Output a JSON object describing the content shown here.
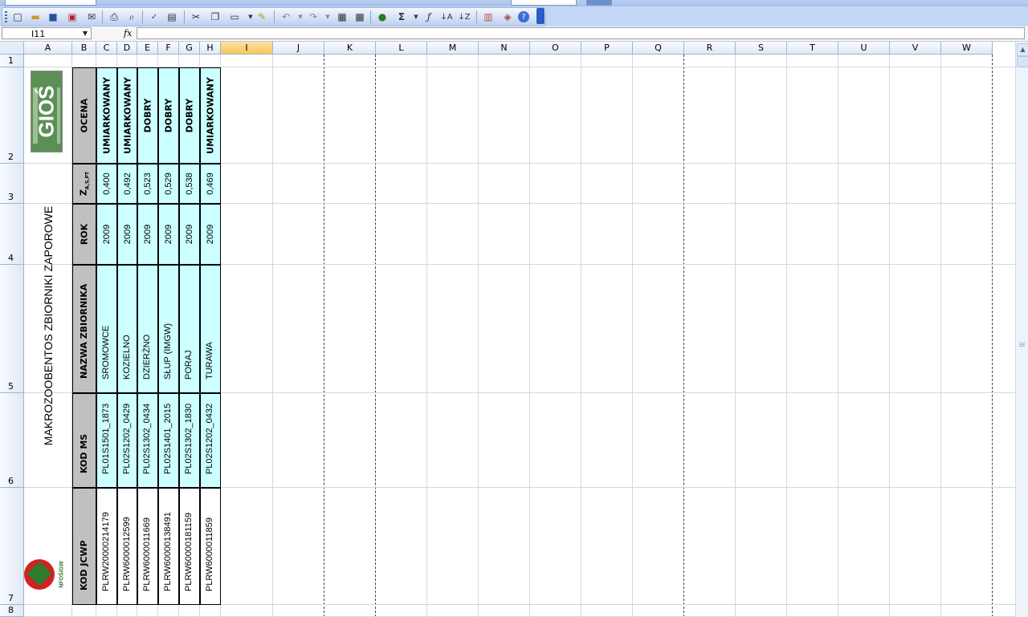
{
  "namebox": {
    "value": "I11"
  },
  "formula": {
    "fx_label": "fx",
    "content": ""
  },
  "columns": [
    "A",
    "B",
    "C",
    "D",
    "E",
    "F",
    "G",
    "H",
    "I",
    "J",
    "K",
    "L",
    "M",
    "N",
    "O",
    "P",
    "Q",
    "R",
    "S",
    "T",
    "U",
    "V",
    "W"
  ],
  "rows": [
    "1",
    "2",
    "3",
    "4",
    "5",
    "6",
    "7",
    "8"
  ],
  "sheet": {
    "title_vertical": "MAKROZOOBENTOS ZBIORNIKI ZAPOROWE",
    "logo_top_text": "GIOŚ",
    "logo_bottom_text": "NFOŚiGW",
    "headers": {
      "ocena": "OCENA",
      "z": "Z",
      "z_sub": "A,S,PT",
      "rok": "ROK",
      "nazwa": "NAZWA ZBIORNIKA",
      "kod_ms": "KOD MS",
      "kod_jcwp": "KOD JCWP"
    },
    "records": [
      {
        "ocena": "UMIARKOWANY",
        "z": "0,400",
        "rok": "2009",
        "nazwa": "SROMOWCE",
        "kod_ms": "PL01S1501_1873",
        "kod_jcwp": "PLRW2000021417​9"
      },
      {
        "ocena": "UMIARKOWANY",
        "z": "0,492",
        "rok": "2009",
        "nazwa": "KOZIELNO",
        "kod_ms": "PL02S1202_0429",
        "kod_jcwp": "PLRW600001259​9"
      },
      {
        "ocena": "DOBRY",
        "z": "0,523",
        "rok": "2009",
        "nazwa": "DZIERŻNO",
        "kod_ms": "PL02S1302_0434",
        "kod_jcwp": "PLRW600001166​9"
      },
      {
        "ocena": "DOBRY",
        "z": "0,529",
        "rok": "2009",
        "nazwa": "SŁUP (IMGW)",
        "kod_ms": "PL02S1401_2015",
        "kod_jcwp": "PLRW60000138491"
      },
      {
        "ocena": "DOBRY",
        "z": "0,538",
        "rok": "2009",
        "nazwa": "PORAJ",
        "kod_ms": "PL02S1302_1830",
        "kod_jcwp": "PLRW60000181159"
      },
      {
        "ocena": "UMIARKOWANY",
        "z": "0,469",
        "rok": "2009",
        "nazwa": "TURAWA",
        "kod_ms": "PL02S1202_0432",
        "kod_jcwp": "PLRW600001185​9"
      }
    ]
  }
}
